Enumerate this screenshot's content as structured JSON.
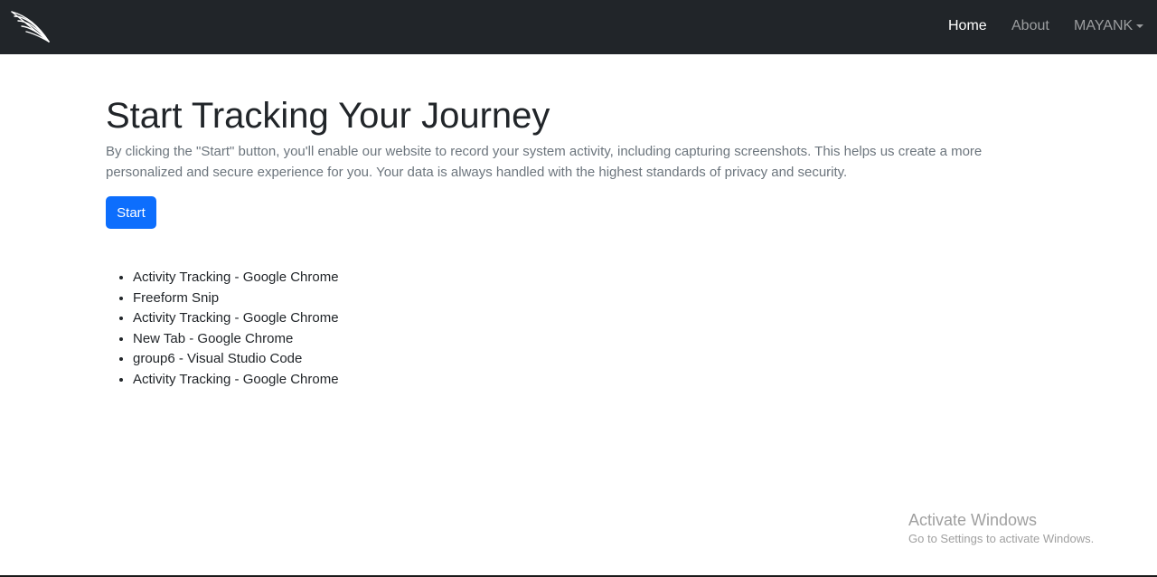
{
  "navbar": {
    "logo_icon": "feather-icon",
    "links": [
      {
        "label": "Home",
        "active": true
      },
      {
        "label": "About",
        "active": false
      }
    ],
    "user_menu": {
      "label": "MAYANK",
      "icon": "caret-down-icon"
    }
  },
  "main": {
    "title": "Start Tracking Your Journey",
    "description": "By clicking the \"Start\" button, you'll enable our website to record your system activity, including capturing screenshots. This helps us create a more personalized and secure experience for you. Your data is always handled with the highest standards of privacy and security.",
    "start_button": "Start",
    "activities": [
      "Activity Tracking - Google Chrome",
      "Freeform Snip",
      "Activity Tracking - Google Chrome",
      "New Tab - Google Chrome",
      "group6 - Visual Studio Code",
      "Activity Tracking - Google Chrome"
    ]
  },
  "watermark": {
    "title": "Activate Windows",
    "subtitle": "Go to Settings to activate Windows."
  },
  "colors": {
    "navbar_bg": "#212529",
    "primary": "#0d6efd",
    "muted_text": "#6c757d"
  }
}
